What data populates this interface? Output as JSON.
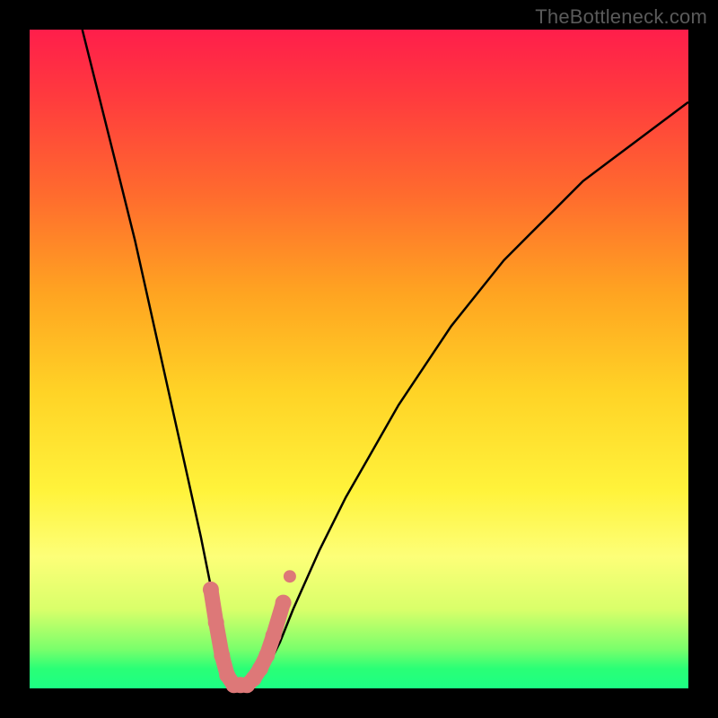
{
  "watermark": "TheBottleneck.com",
  "colors": {
    "background": "#000000",
    "curve_stroke": "#000000",
    "marker_fill": "#dd7878",
    "marker_stroke": "#dd7878"
  },
  "chart_data": {
    "type": "line",
    "title": "",
    "xlabel": "",
    "ylabel": "",
    "xlim": [
      0,
      100
    ],
    "ylim": [
      0,
      100
    ],
    "grid": false,
    "gradient_background": true,
    "series": [
      {
        "name": "bottleneck-curve",
        "x": [
          8,
          10,
          12,
          14,
          16,
          18,
          20,
          22,
          24,
          26,
          28,
          29,
          30,
          31,
          32,
          33,
          34,
          36,
          38,
          40,
          44,
          48,
          52,
          56,
          60,
          64,
          68,
          72,
          76,
          80,
          84,
          88,
          92,
          96,
          100
        ],
        "values": [
          100,
          92,
          84,
          76,
          68,
          59,
          50,
          41,
          32,
          23,
          13,
          8,
          4,
          1,
          0.5,
          0.5,
          1,
          3,
          7,
          12,
          21,
          29,
          36,
          43,
          49,
          55,
          60,
          65,
          69,
          73,
          77,
          80,
          83,
          86,
          89
        ]
      }
    ],
    "markers": [
      {
        "x": 27.5,
        "y": 15
      },
      {
        "x": 28.3,
        "y": 10
      },
      {
        "x": 29.2,
        "y": 5
      },
      {
        "x": 30.0,
        "y": 2
      },
      {
        "x": 31.0,
        "y": 0.5
      },
      {
        "x": 32.0,
        "y": 0.5
      },
      {
        "x": 33.0,
        "y": 0.5
      },
      {
        "x": 34.0,
        "y": 1.5
      },
      {
        "x": 35.0,
        "y": 3
      },
      {
        "x": 36.0,
        "y": 5
      },
      {
        "x": 37.0,
        "y": 8
      },
      {
        "x": 38.5,
        "y": 13
      }
    ],
    "marker_detached": {
      "x": 39.5,
      "y": 17
    }
  }
}
